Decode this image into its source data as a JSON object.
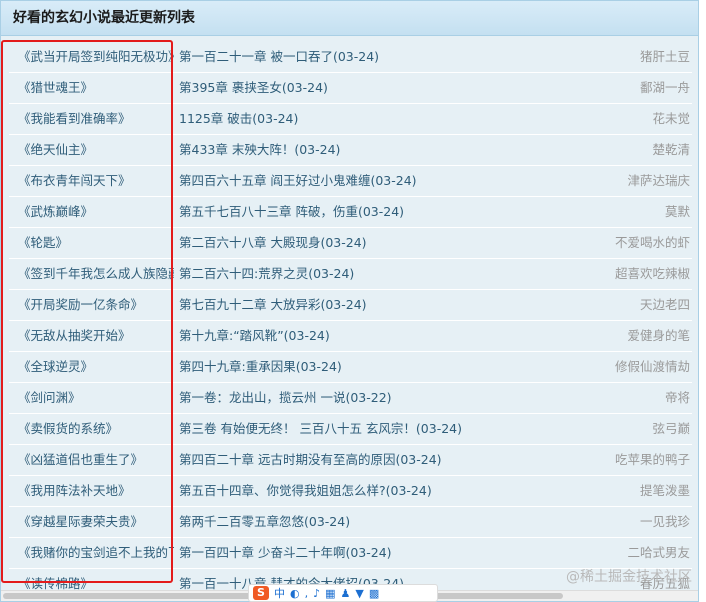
{
  "header": {
    "title": "好看的玄幻小说最近更新列表"
  },
  "rows": [
    {
      "title": "《武当开局签到纯阳无极功》",
      "chapter": "第一百二十一章 被一口吞了(03-24)",
      "author": "猪肝土豆"
    },
    {
      "title": "《猎世魂王》",
      "chapter": "第395章 裹挟圣女(03-24)",
      "author": "鄱湖一舟"
    },
    {
      "title": "《我能看到准确率》",
      "chapter": "1125章 破击(03-24)",
      "author": "花未觉"
    },
    {
      "title": "《绝天仙主》",
      "chapter": "第433章 末殃大阵！(03-24)",
      "author": "楚乾清"
    },
    {
      "title": "《布衣青年闯天下》",
      "chapter": "第四百六十五章 阎王好过小鬼难缠(03-24)",
      "author": "津萨达瑞庆"
    },
    {
      "title": "《武炼巅峰》",
      "chapter": "第五千七百八十三章 阵破，伤重(03-24)",
      "author": "莫默"
    },
    {
      "title": "《轮匙》",
      "chapter": "第二百六十八章 大殿现身(03-24)",
      "author": "不爱喝水的虾"
    },
    {
      "title": "《签到千年我怎么成人族隐藏",
      "chapter": "第二百六十四:荒界之灵(03-24)",
      "author": "超喜欢吃辣椒"
    },
    {
      "title": "《开局奖励一亿条命》",
      "chapter": "第七百九十二章 大放异彩(03-24)",
      "author": "天边老四"
    },
    {
      "title": "《无敌从抽奖开始》",
      "chapter": "第十九章:“踏风靴”(03-24)",
      "author": "爱健身的笔"
    },
    {
      "title": "《全球逆灵》",
      "chapter": "第四十九章:重承因果(03-24)",
      "author": "修假仙渡情劫"
    },
    {
      "title": "《剑问渊》",
      "chapter": "第一卷：龙出山，揽云州 一说(03-22)",
      "author": "帝将"
    },
    {
      "title": "《卖假货的系统》",
      "chapter": "第三卷 有始便无终！ 三百八十五 玄风宗！(03-24)",
      "author": "弦弓巅"
    },
    {
      "title": "《凶猛道侣也重生了》",
      "chapter": "第四百二十章 远古时期没有至高的原因(03-24)",
      "author": "吃苹果的鸭子"
    },
    {
      "title": "《我用阵法补天地》",
      "chapter": "第五百十四章、你觉得我姐姐怎么样?(03-24)",
      "author": "提笔泼墨"
    },
    {
      "title": "《穿越星际妻荣夫贵》",
      "chapter": "第两千二百零五章忽悠(03-24)",
      "author": "一见我珍"
    },
    {
      "title": "《我赌你的宝剑追不上我的飞",
      "chapter": "第一百四十章 少奋斗二十年啊(03-24)",
      "author": "二哈式男友"
    },
    {
      "title": "《读传棉路》",
      "chapter": "第一百一十八章 彗才的今大佬招(03-24)",
      "author": "春厉五狐"
    }
  ],
  "watermark": "@稀土掘金技术社区",
  "ime": {
    "logo": "S",
    "mode": "中",
    "icons": [
      "moon-icon",
      "mic-icon",
      "keyboard-icon",
      "user-icon",
      "shirt-icon",
      "grid-icon"
    ]
  }
}
